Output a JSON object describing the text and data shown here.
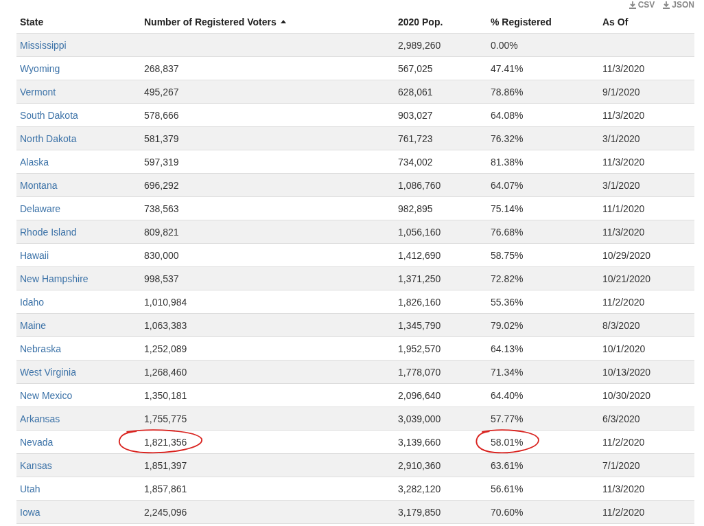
{
  "exports": [
    "CSV",
    "JSON"
  ],
  "columns": [
    {
      "label": "State",
      "sorted": false
    },
    {
      "label": "Number of Registered Voters",
      "sorted": true
    },
    {
      "label": "2020 Pop.",
      "sorted": false
    },
    {
      "label": "% Registered",
      "sorted": false
    },
    {
      "label": "As Of",
      "sorted": false
    }
  ],
  "rows": [
    {
      "state": "Mississippi",
      "voters": "",
      "pop": "2,989,260",
      "pct": "0.00%",
      "as_of": "",
      "voters_circled": false,
      "pct_circled": false
    },
    {
      "state": "Wyoming",
      "voters": "268,837",
      "pop": "567,025",
      "pct": "47.41%",
      "as_of": "11/3/2020",
      "voters_circled": false,
      "pct_circled": false
    },
    {
      "state": "Vermont",
      "voters": "495,267",
      "pop": "628,061",
      "pct": "78.86%",
      "as_of": "9/1/2020",
      "voters_circled": false,
      "pct_circled": false
    },
    {
      "state": "South Dakota",
      "voters": "578,666",
      "pop": "903,027",
      "pct": "64.08%",
      "as_of": "11/3/2020",
      "voters_circled": false,
      "pct_circled": false
    },
    {
      "state": "North Dakota",
      "voters": "581,379",
      "pop": "761,723",
      "pct": "76.32%",
      "as_of": "3/1/2020",
      "voters_circled": false,
      "pct_circled": false
    },
    {
      "state": "Alaska",
      "voters": "597,319",
      "pop": "734,002",
      "pct": "81.38%",
      "as_of": "11/3/2020",
      "voters_circled": false,
      "pct_circled": false
    },
    {
      "state": "Montana",
      "voters": "696,292",
      "pop": "1,086,760",
      "pct": "64.07%",
      "as_of": "3/1/2020",
      "voters_circled": false,
      "pct_circled": false
    },
    {
      "state": "Delaware",
      "voters": "738,563",
      "pop": "982,895",
      "pct": "75.14%",
      "as_of": "11/1/2020",
      "voters_circled": false,
      "pct_circled": false
    },
    {
      "state": "Rhode Island",
      "voters": "809,821",
      "pop": "1,056,160",
      "pct": "76.68%",
      "as_of": "11/3/2020",
      "voters_circled": false,
      "pct_circled": false
    },
    {
      "state": "Hawaii",
      "voters": "830,000",
      "pop": "1,412,690",
      "pct": "58.75%",
      "as_of": "10/29/2020",
      "voters_circled": false,
      "pct_circled": false
    },
    {
      "state": "New Hampshire",
      "voters": "998,537",
      "pop": "1,371,250",
      "pct": "72.82%",
      "as_of": "10/21/2020",
      "voters_circled": false,
      "pct_circled": false
    },
    {
      "state": "Idaho",
      "voters": "1,010,984",
      "pop": "1,826,160",
      "pct": "55.36%",
      "as_of": "11/2/2020",
      "voters_circled": false,
      "pct_circled": false
    },
    {
      "state": "Maine",
      "voters": "1,063,383",
      "pop": "1,345,790",
      "pct": "79.02%",
      "as_of": "8/3/2020",
      "voters_circled": false,
      "pct_circled": false
    },
    {
      "state": "Nebraska",
      "voters": "1,252,089",
      "pop": "1,952,570",
      "pct": "64.13%",
      "as_of": "10/1/2020",
      "voters_circled": false,
      "pct_circled": false
    },
    {
      "state": "West Virginia",
      "voters": "1,268,460",
      "pop": "1,778,070",
      "pct": "71.34%",
      "as_of": "10/13/2020",
      "voters_circled": false,
      "pct_circled": false
    },
    {
      "state": "New Mexico",
      "voters": "1,350,181",
      "pop": "2,096,640",
      "pct": "64.40%",
      "as_of": "10/30/2020",
      "voters_circled": false,
      "pct_circled": false
    },
    {
      "state": "Arkansas",
      "voters": "1,755,775",
      "pop": "3,039,000",
      "pct": "57.77%",
      "as_of": "6/3/2020",
      "voters_circled": false,
      "pct_circled": false
    },
    {
      "state": "Nevada",
      "voters": "1,821,356",
      "pop": "3,139,660",
      "pct": "58.01%",
      "as_of": "11/2/2020",
      "voters_circled": true,
      "pct_circled": true
    },
    {
      "state": "Kansas",
      "voters": "1,851,397",
      "pop": "2,910,360",
      "pct": "63.61%",
      "as_of": "7/1/2020",
      "voters_circled": false,
      "pct_circled": false
    },
    {
      "state": "Utah",
      "voters": "1,857,861",
      "pop": "3,282,120",
      "pct": "56.61%",
      "as_of": "11/3/2020",
      "voters_circled": false,
      "pct_circled": false
    },
    {
      "state": "Iowa",
      "voters": "2,245,096",
      "pop": "3,179,850",
      "pct": "70.60%",
      "as_of": "11/2/2020",
      "voters_circled": false,
      "pct_circled": false
    }
  ]
}
